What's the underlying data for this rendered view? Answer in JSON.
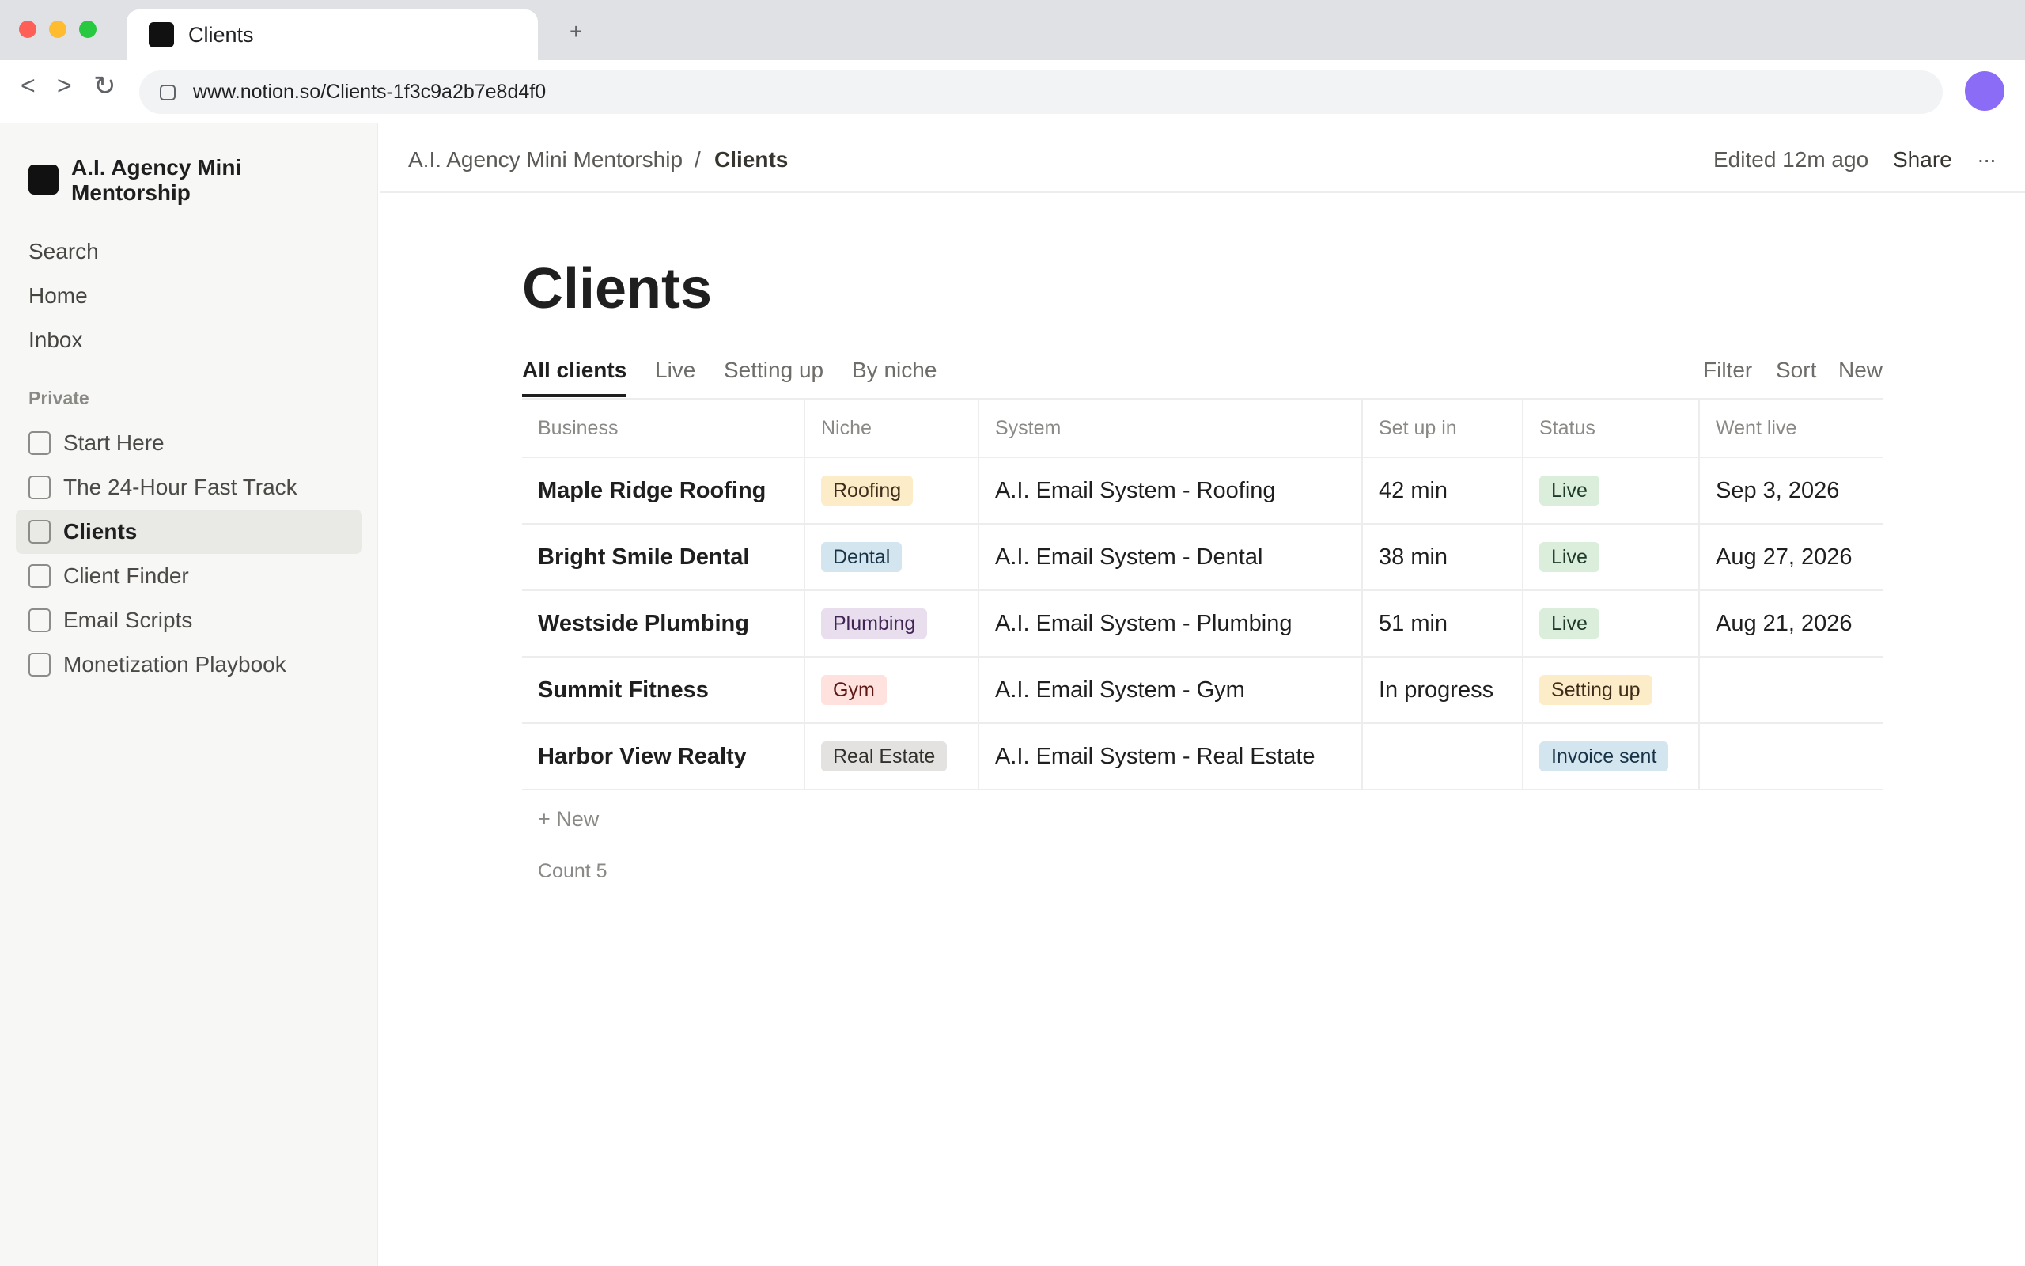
{
  "browser": {
    "tab_title": "Clients",
    "new_tab_label": "+",
    "back_label": "<",
    "forward_label": ">",
    "reload_label": "↻",
    "url": "www.notion.so/Clients-1f3c9a2b7e8d4f0",
    "icons": {
      "favicon": "notion-page-icon",
      "site": "site-info-icon",
      "profile": "profile-avatar"
    },
    "colors": {
      "close": "#fe5f57",
      "minimize": "#febc2e",
      "maximize": "#28c840",
      "profile": "#8b6cf7"
    }
  },
  "sidebar": {
    "workspace_name": "A.I. Agency Mini Mentorship",
    "nav": [
      {
        "label": "Search"
      },
      {
        "label": "Home"
      },
      {
        "label": "Inbox"
      }
    ],
    "section_label": "Private",
    "pages": [
      {
        "label": "Start Here",
        "active": false
      },
      {
        "label": "The 24-Hour Fast Track",
        "active": false
      },
      {
        "label": "Clients",
        "active": true
      },
      {
        "label": "Client Finder",
        "active": false
      },
      {
        "label": "Email Scripts",
        "active": false
      },
      {
        "label": "Monetization Playbook",
        "active": false
      }
    ]
  },
  "topbar": {
    "breadcrumb": [
      "A.I. Agency Mini Mentorship",
      "/",
      "Clients"
    ],
    "edited": "Edited 12m ago",
    "share": "Share",
    "more": "..."
  },
  "page": {
    "title": "Clients",
    "views": [
      {
        "label": "All clients",
        "active": true
      },
      {
        "label": "Live",
        "active": false
      },
      {
        "label": "Setting up",
        "active": false
      },
      {
        "label": "By niche",
        "active": false
      }
    ],
    "actions": [
      "Filter",
      "Sort",
      "New"
    ],
    "columns": [
      "Business",
      "Niche",
      "System",
      "Set up in",
      "Status",
      "Went live"
    ],
    "rows": [
      {
        "business": "Maple Ridge Roofing",
        "niche": "Roofing",
        "niche_bg": "#fdecc8",
        "niche_fg": "#402c1b",
        "system": "A.I. Email System - Roofing",
        "setup": "42 min",
        "status": "Live",
        "status_bg": "#dbeddb",
        "status_fg": "#1c3829",
        "went_live": "Sep 3, 2026"
      },
      {
        "business": "Bright Smile Dental",
        "niche": "Dental",
        "niche_bg": "#d3e5ef",
        "niche_fg": "#183347",
        "system": "A.I. Email System - Dental",
        "setup": "38 min",
        "status": "Live",
        "status_bg": "#dbeddb",
        "status_fg": "#1c3829",
        "went_live": "Aug 27, 2026"
      },
      {
        "business": "Westside Plumbing",
        "niche": "Plumbing",
        "niche_bg": "#e8deee",
        "niche_fg": "#412454",
        "system": "A.I. Email System - Plumbing",
        "setup": "51 min",
        "status": "Live",
        "status_bg": "#dbeddb",
        "status_fg": "#1c3829",
        "went_live": "Aug 21, 2026"
      },
      {
        "business": "Summit Fitness",
        "niche": "Gym",
        "niche_bg": "#ffe2dd",
        "niche_fg": "#5d1715",
        "system": "A.I. Email System - Gym",
        "setup": "In progress",
        "status": "Setting up",
        "status_bg": "#fdecc8",
        "status_fg": "#402c1b",
        "went_live": ""
      },
      {
        "business": "Harbor View Realty",
        "niche": "Real Estate",
        "niche_bg": "#e3e2e0",
        "niche_fg": "#32302c",
        "system": "A.I. Email System - Real Estate",
        "setup": "",
        "status": "Invoice sent",
        "status_bg": "#d3e5ef",
        "status_fg": "#183347",
        "went_live": ""
      }
    ],
    "add_new": "+ New",
    "count": "Count 5"
  }
}
